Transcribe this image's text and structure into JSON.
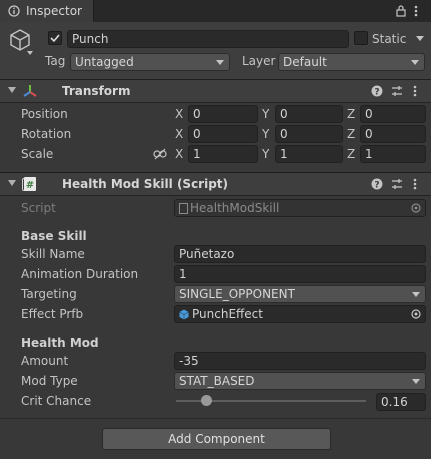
{
  "tab": {
    "title": "Inspector"
  },
  "gameobject": {
    "active": true,
    "name": "Punch",
    "static_label": "Static",
    "tag_label": "Tag",
    "tag_value": "Untagged",
    "layer_label": "Layer",
    "layer_value": "Default"
  },
  "transform": {
    "title": "Transform",
    "position_label": "Position",
    "rotation_label": "Rotation",
    "scale_label": "Scale",
    "axis_x": "X",
    "axis_y": "Y",
    "axis_z": "Z",
    "position": {
      "x": "0",
      "y": "0",
      "z": "0"
    },
    "rotation": {
      "x": "0",
      "y": "0",
      "z": "0"
    },
    "scale": {
      "x": "1",
      "y": "1",
      "z": "1"
    }
  },
  "component": {
    "title": "Health Mod Skill (Script)",
    "script_label": "Script",
    "script_value": "HealthModSkill",
    "base_skill_header": "Base Skill",
    "skill_name_label": "Skill Name",
    "skill_name_value": "Puñetazo",
    "anim_duration_label": "Animation Duration",
    "anim_duration_value": "1",
    "targeting_label": "Targeting",
    "targeting_value": "SINGLE_OPPONENT",
    "effect_label": "Effect Prfb",
    "effect_value": "PunchEffect",
    "health_mod_header": "Health Mod",
    "amount_label": "Amount",
    "amount_value": "-35",
    "mod_type_label": "Mod Type",
    "mod_type_value": "STAT_BASED",
    "crit_label": "Crit Chance",
    "crit_value": "0.16",
    "crit_slider_fraction": 0.16
  },
  "add_component_label": "Add Component",
  "colors": {
    "background": "#383838",
    "header": "#3e3e3e",
    "field": "#2a2a2a",
    "text": "#c4c4c4"
  }
}
